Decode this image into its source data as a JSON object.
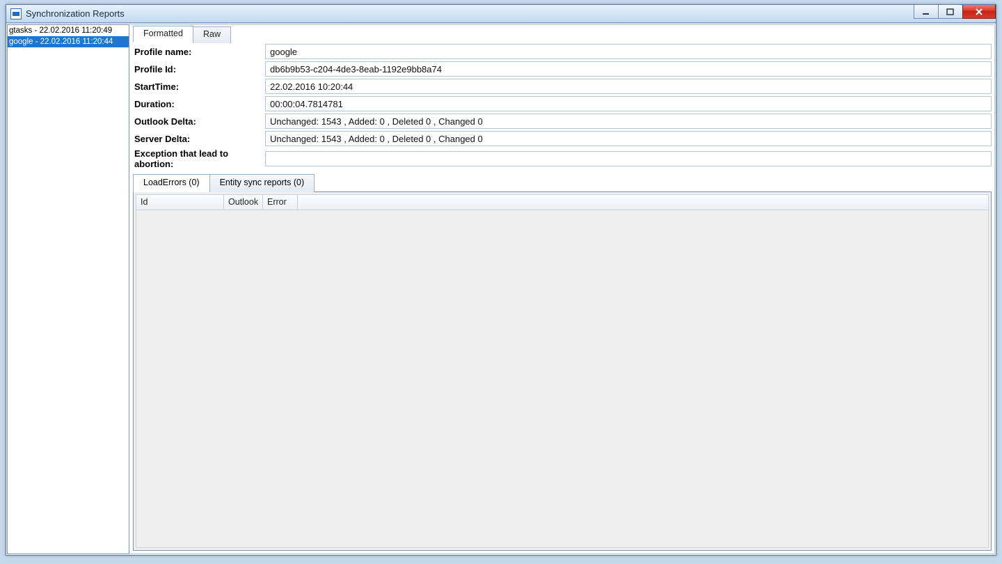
{
  "window": {
    "title": "Synchronization Reports"
  },
  "sidebar": {
    "items": [
      {
        "label": "gtasks - 22.02.2016 11:20:49",
        "selected": false
      },
      {
        "label": "google - 22.02.2016 11:20:44",
        "selected": true
      }
    ]
  },
  "view_tabs": {
    "formatted": "Formatted",
    "raw": "Raw"
  },
  "fields": {
    "profile_name": {
      "label": "Profile name:",
      "value": "google"
    },
    "profile_id": {
      "label": "Profile Id:",
      "value": "db6b9b53-c204-4de3-8eab-1192e9bb8a74"
    },
    "start_time": {
      "label": "StartTime:",
      "value": "22.02.2016 10:20:44"
    },
    "duration": {
      "label": "Duration:",
      "value": "00:00:04.7814781"
    },
    "outlook_delta": {
      "label": "Outlook Delta:",
      "value": "Unchanged: 1543 , Added: 0 , Deleted 0 ,  Changed 0"
    },
    "server_delta": {
      "label": "Server Delta:",
      "value": "Unchanged: 1543 , Added: 0 , Deleted 0 ,  Changed 0"
    },
    "exception": {
      "label": "Exception that lead to abortion:",
      "value": ""
    }
  },
  "sub_tabs": {
    "load_errors": "LoadErrors (0)",
    "entity_sync": "Entity sync reports (0)"
  },
  "grid": {
    "columns": {
      "id": "Id",
      "outlook": "Outlook",
      "error": "Error"
    }
  }
}
